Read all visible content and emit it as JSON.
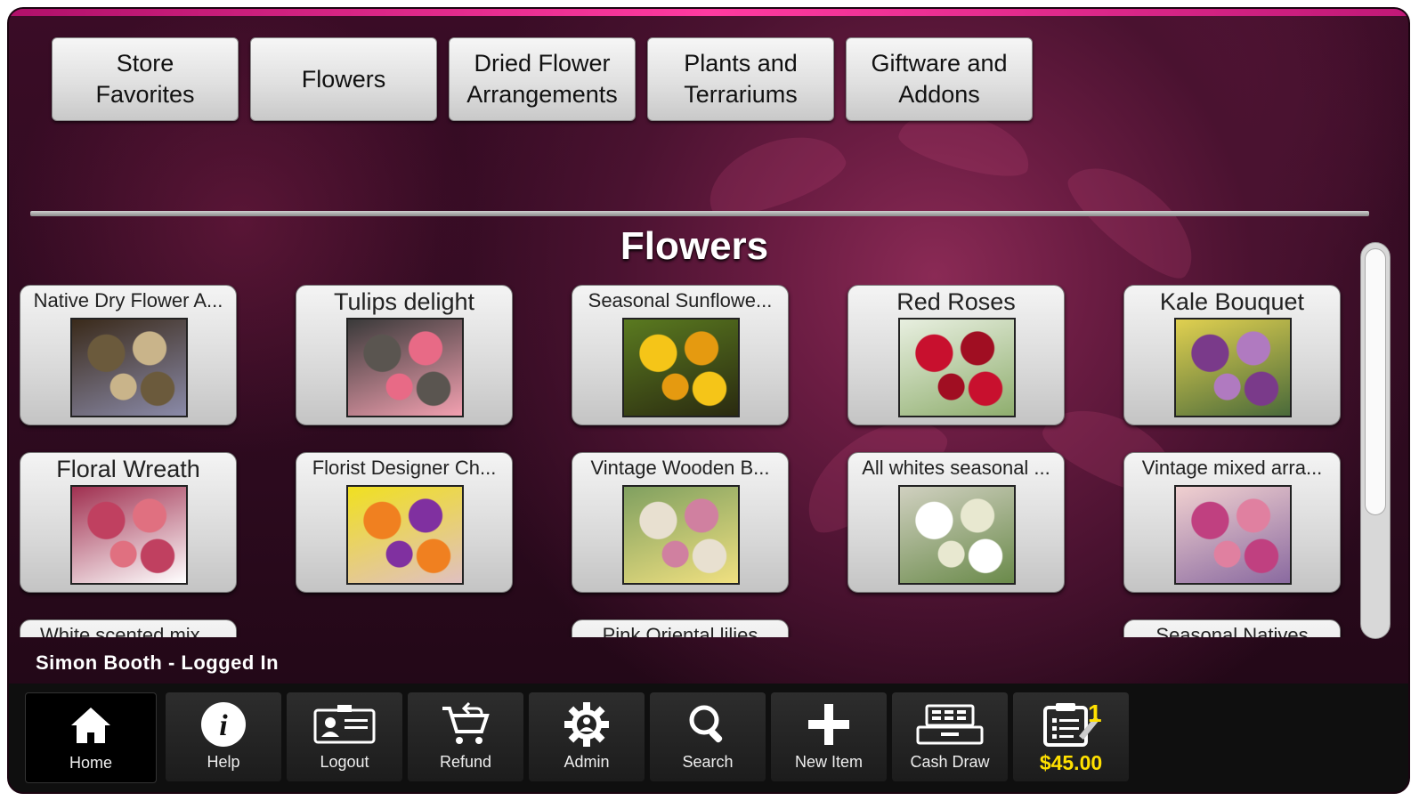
{
  "categories": [
    "Store\nFavorites",
    "Flowers",
    "Dried Flower\nArrangements",
    "Plants and\nTerrariums",
    "Giftware and\nAddons"
  ],
  "section_title": "Flowers",
  "products": [
    {
      "name": "Native Dry Flower A...",
      "size": "small",
      "image": "dried-flowers-image",
      "palette": [
        "#6b5a3c",
        "#c9b48a",
        "#8a8aa8",
        "#3a2a1a"
      ]
    },
    {
      "name": "Tulips delight",
      "size": "big",
      "image": "tulips-image",
      "palette": [
        "#5a5550",
        "#e86a86",
        "#f2a0b0",
        "#3a3a3a"
      ]
    },
    {
      "name": "Seasonal Sunflowe...",
      "size": "small",
      "image": "sunflowers-image",
      "palette": [
        "#f5c518",
        "#e59a10",
        "#2a2a10",
        "#5a7a20"
      ]
    },
    {
      "name": "Red Roses",
      "size": "big",
      "image": "red-roses-image",
      "palette": [
        "#c8102e",
        "#a00e22",
        "#8fae6e",
        "#e8efe0"
      ]
    },
    {
      "name": "Kale Bouquet",
      "size": "big",
      "image": "kale-bouquet-image",
      "palette": [
        "#7a3a8a",
        "#b07ac0",
        "#4a6a3a",
        "#e0d050"
      ]
    },
    {
      "name": "Floral Wreath",
      "size": "big",
      "image": "floral-wreath-image",
      "palette": [
        "#c04060",
        "#e07080",
        "#ffffff",
        "#a03050"
      ]
    },
    {
      "name": "Florist Designer Ch...",
      "size": "small",
      "image": "florist-designer-image",
      "palette": [
        "#f08020",
        "#8030a0",
        "#e0c0c0",
        "#f0e020"
      ]
    },
    {
      "name": "Vintage Wooden B...",
      "size": "small",
      "image": "vintage-wooden-image",
      "palette": [
        "#e8e0d0",
        "#d080a0",
        "#f0e080",
        "#80a060"
      ]
    },
    {
      "name": "All whites seasonal ...",
      "size": "small",
      "image": "all-whites-image",
      "palette": [
        "#ffffff",
        "#e8e8d0",
        "#6a8a4a",
        "#d0d0c0"
      ]
    },
    {
      "name": "Vintage mixed arra...",
      "size": "small",
      "image": "vintage-mixed-image",
      "palette": [
        "#c04080",
        "#e080a0",
        "#8a6aa0",
        "#f0d0d0"
      ]
    },
    {
      "name": "White scented mix...",
      "size": "small"
    },
    {
      "name": "Pink Oriental lilies",
      "size": "small",
      "col": 2
    },
    {
      "name": "Seasonal Natives",
      "size": "small",
      "col": 4
    }
  ],
  "status": {
    "user_status": "Simon Booth - Logged In"
  },
  "toolbar": {
    "home": "Home",
    "help": "Help",
    "logout": "Logout",
    "refund": "Refund",
    "admin": "Admin",
    "search": "Search",
    "new_item": "New Item",
    "cash_draw": "Cash Draw",
    "cart_count": "1",
    "cart_total": "$45.00"
  }
}
